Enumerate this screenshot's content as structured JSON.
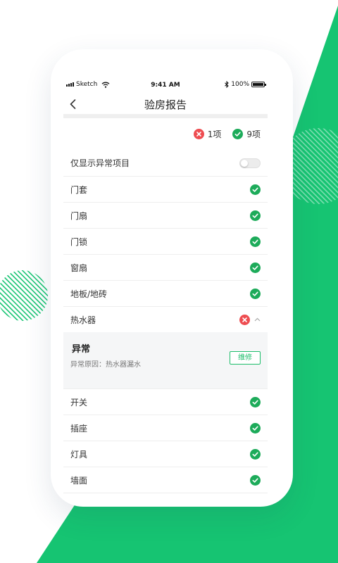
{
  "colors": {
    "accent": "#16c472",
    "error": "#ee4d51",
    "ok": "#1dab5a"
  },
  "status_bar": {
    "carrier": "Sketch",
    "time": "9:41 AM",
    "battery": "100%",
    "battery_level": 1.0
  },
  "nav": {
    "title": "验房报告",
    "back_icon": "chevron-left-icon"
  },
  "summary": {
    "abnormal_count": "1项",
    "normal_count": "9项"
  },
  "filter": {
    "label": "仅显示异常项目",
    "enabled": false
  },
  "items": [
    {
      "label": "门套",
      "status": "ok"
    },
    {
      "label": "门扇",
      "status": "ok"
    },
    {
      "label": "门锁",
      "status": "ok"
    },
    {
      "label": "窗扇",
      "status": "ok"
    },
    {
      "label": "地板/地砖",
      "status": "ok"
    },
    {
      "label": "热水器",
      "status": "error"
    },
    {
      "label": "开关",
      "status": "ok"
    },
    {
      "label": "插座",
      "status": "ok"
    },
    {
      "label": "灯具",
      "status": "ok"
    },
    {
      "label": "墙面",
      "status": "ok"
    }
  ],
  "abnormal_detail": {
    "title": "异常",
    "reason": "异常原因：热水器漏水",
    "repair_button": "维修"
  }
}
